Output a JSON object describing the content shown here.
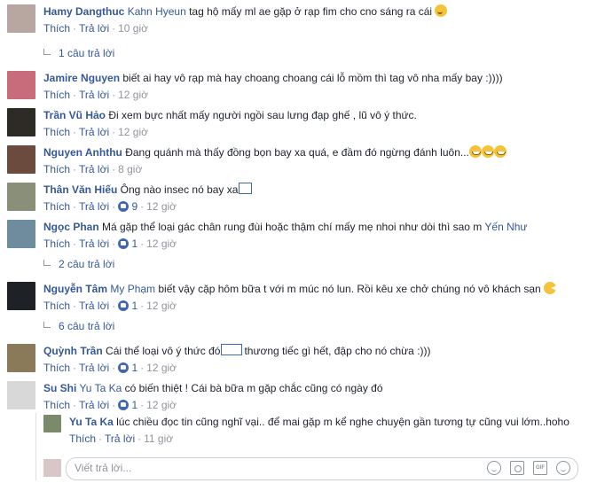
{
  "common": {
    "like": "Thích",
    "reply": "Trả lời",
    "dot": "·"
  },
  "comments": [
    {
      "name": "Hamy Dangthuc",
      "tag": "Kahn Hyeun",
      "text": " tag hộ mấy ml ae gặp ở rạp fim cho cno sáng ra cái ",
      "emoji": "smile",
      "time": "10 giờ",
      "avatar_color": "#b8a6a0"
    },
    {
      "name": "Jamire Nguyen",
      "text": " biết ai hay vô rạp mà hay choang choang cái lỗ mồm thì tag vô nha mấy bay :))))",
      "time": "12 giờ",
      "avatar_color": "#c86b7a"
    },
    {
      "name": "Trần Vũ Hảo",
      "text": " Đi xem bực nhất mấy người ngồi sau lưng đạp ghế , lũ vô ý thức.",
      "time": "12 giờ",
      "avatar_color": "#2e2a26"
    },
    {
      "name": "Nguyen Anhthu",
      "text": " Đang quánh mà thấy đồng bọn bay xa quá, e đầm đó ngừng đánh luôn...",
      "time": "8 giờ",
      "avatar_color": "#6b4b3e"
    },
    {
      "name": "Thân Văn Hiếu",
      "text": " Ông nào insec nó bay xa",
      "time": "12 giờ",
      "likes": "9",
      "avatar_color": "#8a8f7a"
    },
    {
      "name": "Ngọc Phan",
      "text": " Má gặp thể loại gác chân rung đùi hoặc thậm chí mấy mẹ nhoi như dòi thì sao m ",
      "tag_after": "Yến Như",
      "time": "12 giờ",
      "likes": "1",
      "avatar_color": "#6e8c9e"
    },
    {
      "name": "Nguyễn Tâm",
      "tag": "My Phạm",
      "text": " biết vậy cặp hôm bữa t với m múc nó lun. Rồi kêu xe chở chúng nó vô khách sạn ",
      "time": "12 giờ",
      "likes": "1",
      "avatar_color": "#1e2226"
    },
    {
      "name": "Quỳnh Trần",
      "text": " Cái thể loại vô ý thức đó",
      "text2": "thương tiếc gì hết, đập cho nó chừa :)))",
      "time": "12 giờ",
      "likes": "1",
      "avatar_color": "#8a7a5a"
    },
    {
      "name": "Su Shi",
      "tag": "Yu Ta Ka",
      "text": " có biến thiệt ! Cái bà bữa m gặp chắc cũng có ngày đó",
      "time": "12 giờ",
      "likes": "1",
      "avatar_color": "#d8d8d8"
    }
  ],
  "reply_counts": [
    "1 câu trả lời",
    "2 câu trả lời",
    "6 câu trả lời"
  ],
  "nested_reply": {
    "name": "Yu Ta Ka",
    "text": " lúc chiều đọc tin cũng nghĩ vại.. để mai gặp m kể nghe chuyện gần tương tự cũng vui lớm..hoho",
    "time": "11 giờ",
    "avatar_color": "#7a8a6a"
  },
  "write_reply": {
    "placeholder": "Viết trả lời...",
    "gif_label": "GIF"
  }
}
